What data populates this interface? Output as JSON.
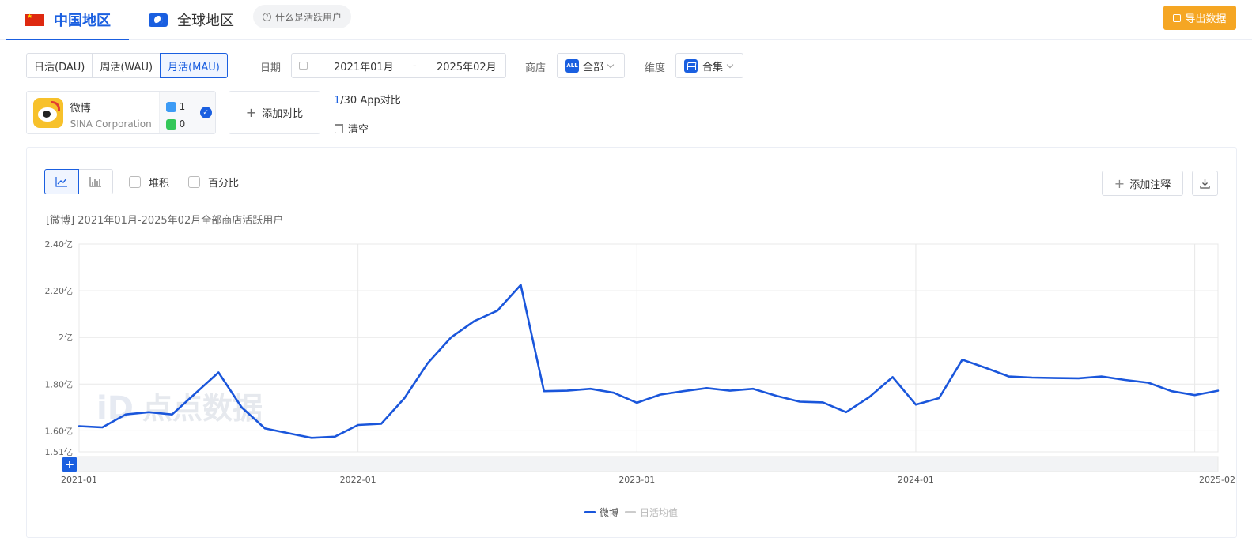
{
  "region_tabs": [
    {
      "label": "中国地区",
      "active": true
    },
    {
      "label": "全球地区",
      "active": false
    }
  ],
  "what_active": "什么是活跃用户",
  "export_label": "导出数据",
  "metric_tabs": [
    {
      "label": "日活(DAU)",
      "active": false
    },
    {
      "label": "周活(WAU)",
      "active": false
    },
    {
      "label": "月活(MAU)",
      "active": true
    }
  ],
  "date": {
    "label": "日期",
    "start": "2021年01月",
    "sep": "-",
    "end": "2025年02月"
  },
  "store": {
    "label": "商店",
    "icon_text": "ALL",
    "value": "全部"
  },
  "dimension": {
    "label": "维度",
    "value": "合集"
  },
  "app": {
    "name": "微博",
    "company": "SINA Corporation",
    "ios_count": "1",
    "android_count": "0"
  },
  "add_compare_label": "添加对比",
  "compare_count": {
    "current": "1",
    "rest": "/30 App对比"
  },
  "clear_label": "清空",
  "options": {
    "stack": "堆积",
    "percent": "百分比"
  },
  "add_annotation_label": "添加注释",
  "chart_data": {
    "type": "line",
    "title": "[微博] 2021年01月-2025年02月全部商店活跃用户",
    "yticks": [
      "2.40亿",
      "2.20亿",
      "2亿",
      "1.80亿",
      "1.60亿",
      "1.51亿"
    ],
    "ytick_values": [
      2.4,
      2.2,
      2.0,
      1.8,
      1.6,
      1.51
    ],
    "ylim": [
      1.51,
      2.4
    ],
    "unit": "亿",
    "xticks": [
      "2021-01",
      "2022-01",
      "2023-01",
      "2024-01",
      "2025-02"
    ],
    "x_tick_index": [
      0,
      12,
      24,
      36,
      48
    ],
    "grid": true,
    "watermark": "点点数据",
    "legend": [
      {
        "name": "微博",
        "color": "#1a56db"
      },
      {
        "name": "日活均值",
        "color": "#cccccc"
      }
    ],
    "series": [
      {
        "name": "微博",
        "color": "#1a56db",
        "values": [
          1.62,
          1.615,
          1.67,
          1.68,
          1.67,
          1.76,
          1.85,
          1.7,
          1.61,
          1.59,
          1.57,
          1.575,
          1.625,
          1.63,
          1.74,
          1.89,
          2.0,
          2.07,
          2.115,
          2.225,
          1.77,
          1.772,
          1.78,
          1.763,
          1.72,
          1.755,
          1.77,
          1.783,
          1.772,
          1.78,
          1.75,
          1.725,
          1.722,
          1.68,
          1.745,
          1.83,
          1.712,
          1.74,
          1.905,
          1.87,
          1.833,
          1.828,
          1.826,
          1.825,
          1.833,
          1.818,
          1.806,
          1.77,
          1.753,
          1.772
        ]
      }
    ]
  }
}
